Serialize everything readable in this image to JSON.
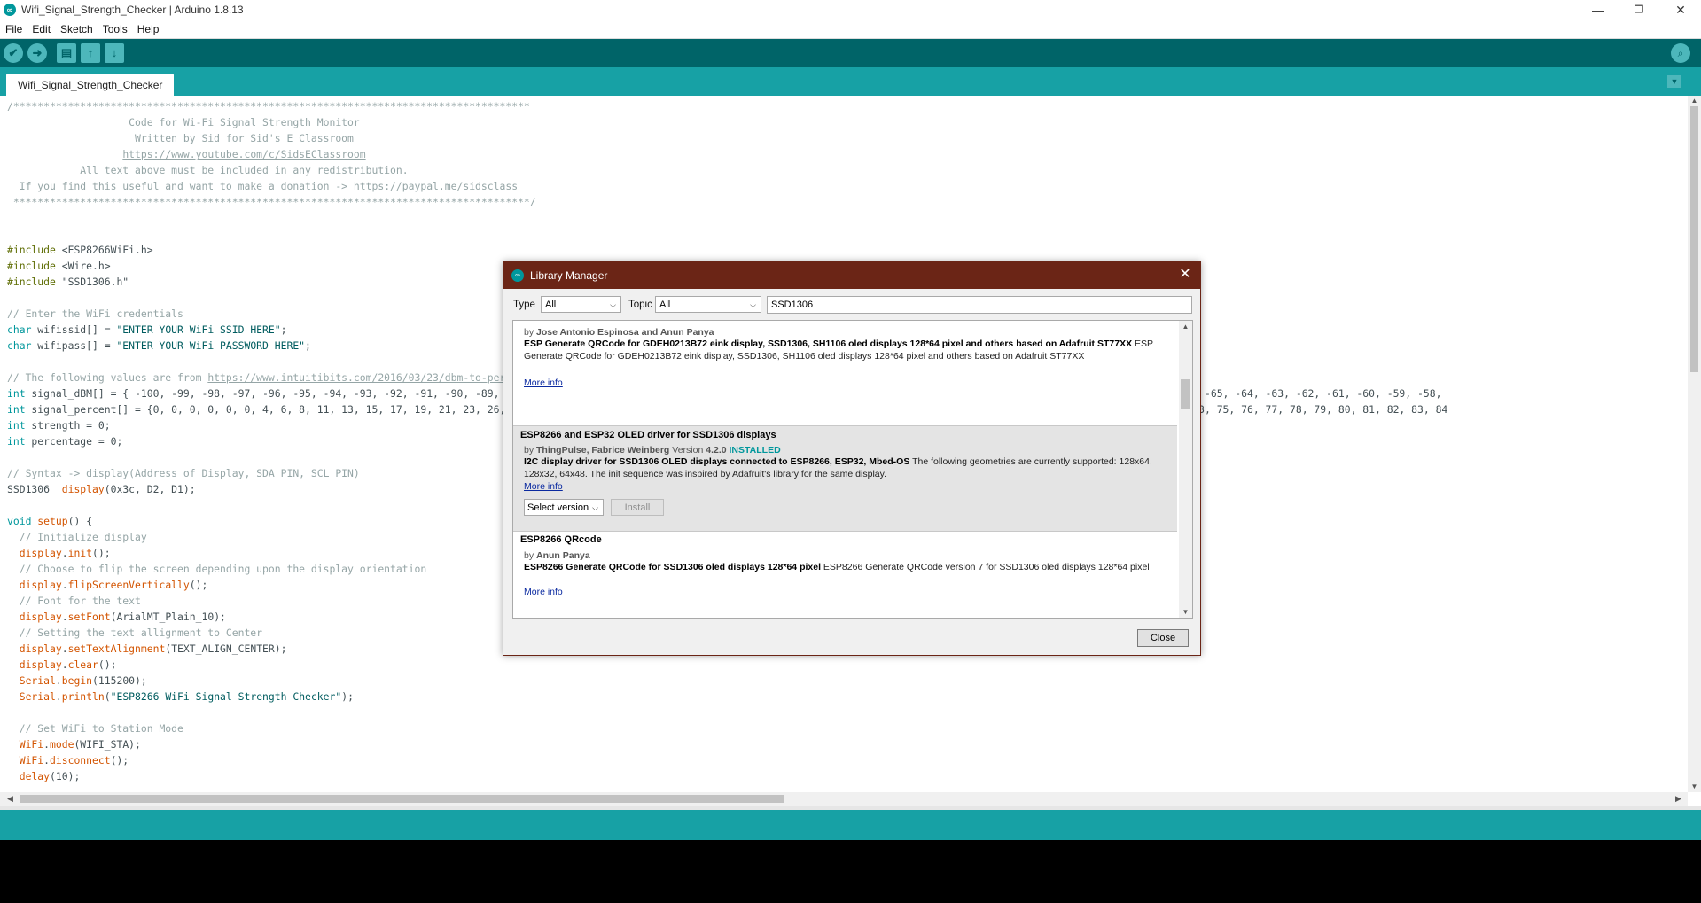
{
  "window": {
    "title": "Wifi_Signal_Strength_Checker | Arduino 1.8.13",
    "minimize": "—",
    "restore": "❐",
    "close": "✕"
  },
  "menu": [
    "File",
    "Edit",
    "Sketch",
    "Tools",
    "Help"
  ],
  "toolbar": {
    "verify": "✔",
    "upload": "➜",
    "new": "▤",
    "open": "↑",
    "save": "↓",
    "serial_monitor": "⌕"
  },
  "tabs": {
    "active": "Wifi_Signal_Strength_Checker",
    "menu_arrow": "▼"
  },
  "code": {
    "lines": [
      "/*************************************************************************************",
      "                    Code for Wi-Fi Signal Strength Monitor",
      "                     Written by Sid for Sid's E Classroom",
      "                   https://www.youtube.com/c/SidsEClassroom",
      "            All text above must be included in any redistribution.",
      "  If you find this useful and want to make a donation -> https://paypal.me/sidsclass",
      " *************************************************************************************/",
      "",
      "",
      "#include <ESP8266WiFi.h>",
      "#include <Wire.h>",
      "#include \"SSD1306.h\"",
      "",
      "// Enter the WiFi credentials",
      "char wifissid[] = \"ENTER YOUR WiFi SSID HERE\";",
      "char wifipass[] = \"ENTER YOUR WiFi PASSWORD HERE\";",
      "",
      "// The following values are from https://www.intuitibits.com/2016/03/23/dbm-to-percent-conversion/",
      "int signal_dBM[] = { -100, -99, -98, -97, -96, -95, -94, -93, -92, -91, -90, -89, -88, -87, -86, -85, -84, -83, -82, -81, -80, -79, -78, -77, -76, -75, -74, -73, -72, -71, -70, -69, -68, -67, -66, -65, -64, -63, -62, -61, -60, -59, -58,",
      "int signal_percent[] = {0, 0, 0, 0, 0, 0, 4, 6, 8, 11, 13, 15, 17, 19, 21, 23, 26, 28, 30, 32, 34, 35, 37, 39, 41, 43, 45, 46, 48, 50, 52, 53, 55, 56, 58, 59, 61, 62, 64, 65, 67, 68, 69, 71, 72, 73, 75, 76, 77, 78, 79, 80, 81, 82, 83, 84",
      "int strength = 0;",
      "int percentage = 0;",
      "",
      "// Syntax -> display(Address of Display, SDA_PIN, SCL_PIN)",
      "SSD1306  display(0x3c, D2, D1);",
      "",
      "void setup() {",
      "  // Initialize display",
      "  display.init();",
      "  // Choose to flip the screen depending upon the display orientation",
      "  display.flipScreenVertically();",
      "  // Font for the text",
      "  display.setFont(ArialMT_Plain_10);",
      "  // Setting the text allignment to Center",
      "  display.setTextAlignment(TEXT_ALIGN_CENTER);",
      "  display.clear();",
      "  Serial.begin(115200);",
      "  Serial.println(\"ESP8266 WiFi Signal Strength Checker\");",
      "",
      "  // Set WiFi to Station Mode",
      "  WiFi.mode(WIFI_STA);",
      "  WiFi.disconnect();",
      "  delay(10);"
    ]
  },
  "dialog": {
    "title": "Library Manager",
    "close_x": "✕",
    "type_label": "Type",
    "type_value": "All",
    "topic_label": "Topic",
    "topic_value": "All",
    "search_value": "SSD1306",
    "close_button": "Close",
    "libraries": [
      {
        "name": "",
        "by": "by",
        "authors": "Jose Antonio Espinosa  and Anun Panya",
        "version_label": "",
        "version": "",
        "status": "",
        "summary": "ESP Generate QRCode for GDEH0213B72 eink display, SSD1306, SH1106 oled displays 128*64 pixel and others based on Adafruit ST77XX",
        "description": "ESP Generate QRCode for GDEH0213B72 eink display, SSD1306, SH1106 oled displays 128*64 pixel and others based on Adafruit ST77XX",
        "more_info": "More info"
      },
      {
        "name": "ESP8266 and ESP32 OLED driver for SSD1306 displays",
        "by": "by",
        "authors": "ThingPulse, Fabrice Weinberg",
        "version_label": "Version",
        "version": "4.2.0",
        "status": "INSTALLED",
        "summary": "I2C display driver for SSD1306 OLED displays connected to ESP8266, ESP32, Mbed-OS",
        "description": "The following geometries are currently supported: 128x64, 128x32, 64x48. The init sequence was inspired by Adafruit's library for the same display.",
        "more_info": "More info",
        "select_version": "Select version",
        "install": "Install"
      },
      {
        "name": "ESP8266 QRcode",
        "by": "by",
        "authors": "Anun Panya",
        "version_label": "",
        "version": "",
        "status": "",
        "summary": "ESP8266 Generate QRCode for SSD1306 oled displays 128*64 pixel",
        "description": "ESP8266 Generate QRCode version 7 for SSD1306 oled displays 128*64 pixel",
        "more_info": "More info"
      }
    ]
  },
  "colors": {
    "toolbar": "#006468",
    "tabbar": "#17a1a5",
    "dialog_title": "#6b2516",
    "accent": "#00979c"
  }
}
